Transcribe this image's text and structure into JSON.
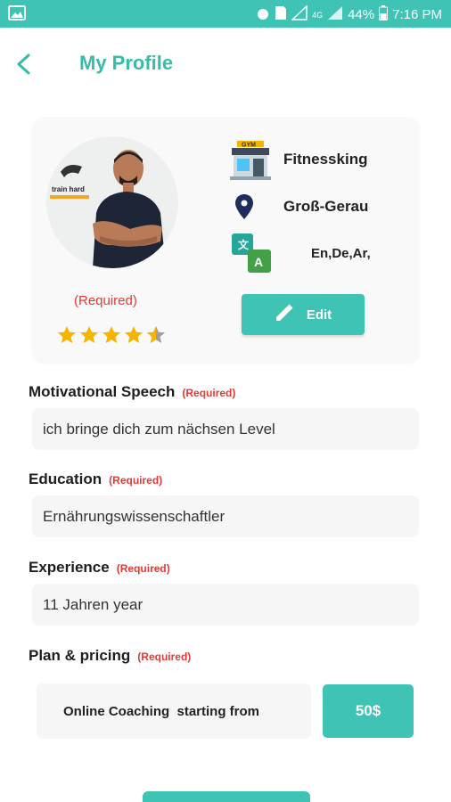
{
  "status_bar": {
    "battery": "44%",
    "time": "7:16 PM",
    "network": "4G"
  },
  "header": {
    "title": "My Profile"
  },
  "profile": {
    "required_note": "(Required)",
    "rating": 4.5,
    "gym_name": "Fitnessking",
    "location": "Groß-Gerau",
    "languages": "En,De,Ar,",
    "edit_label": "Edit",
    "avatar_badge": "train hard"
  },
  "sections": {
    "motivational": {
      "label": "Motivational Speech",
      "required": "(Required)",
      "value": "ich bringe dich zum nächsen Level"
    },
    "education": {
      "label": "Education",
      "required": "(Required)",
      "value": "Ernährungswissenschaftler"
    },
    "experience": {
      "label": "Experience",
      "required": "(Required)",
      "value": "11 Jahren year"
    },
    "plan": {
      "label": "Plan & pricing",
      "required": "(Required)",
      "offer": "Online Coaching  starting from",
      "price": "50$"
    }
  },
  "colors": {
    "accent": "#3ec3b4",
    "title": "#38bba9",
    "required": "#e53935",
    "star": "#f5b400"
  },
  "icons": [
    "image-icon",
    "sim-icon",
    "signal-icon",
    "battery-icon",
    "back-arrow-icon",
    "gym-icon",
    "location-pin-icon",
    "translate-icon",
    "pencil-icon",
    "star-icon"
  ]
}
